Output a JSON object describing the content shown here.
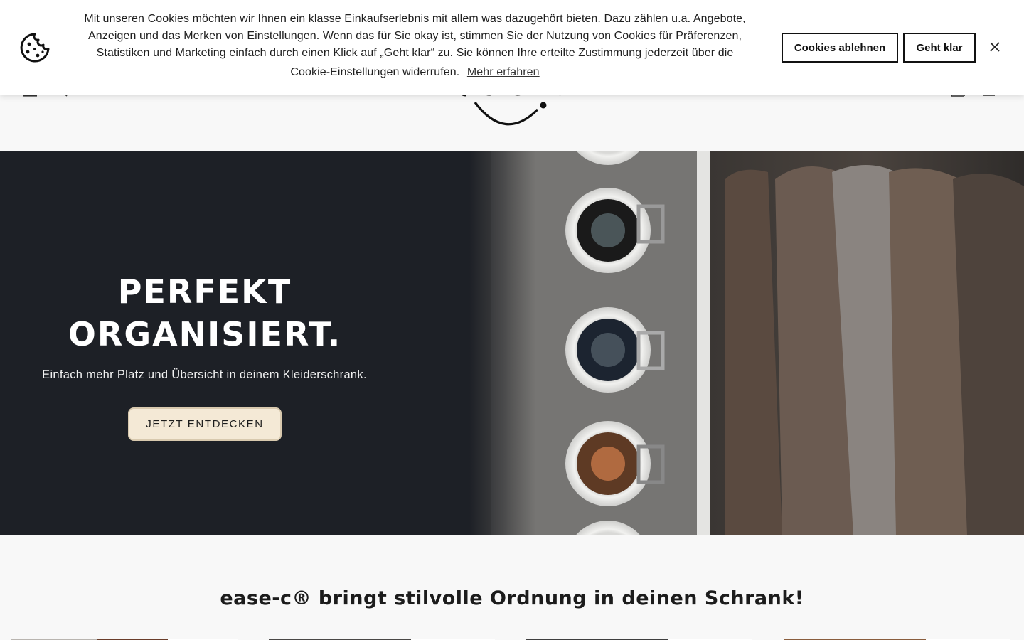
{
  "cookie_banner": {
    "text_lines": [
      "Mit unseren Cookies möchten wir Ihnen ein klasse Einkaufserlebnis mit allem was dazugehört bieten. Dazu zählen u.a. Angebote,",
      "Anzeigen und das Merken von Einstellungen. Wenn das für Sie okay ist, stimmen Sie der Nutzung von Cookies für Präferenzen,",
      "Statistiken und Marketing einfach durch einen Klick auf „Geht klar“ zu. Sie können Ihre erteilte Zustimmung jederzeit über die",
      "Cookie-Einstellungen widerrufen."
    ],
    "learn_more": "Mehr erfahren",
    "decline_label": "Cookies ablehnen",
    "accept_label": "Geht klar",
    "icon": "cookie-icon",
    "close_icon": "close-icon"
  },
  "header": {
    "icons": [
      "menu-icon",
      "search-icon",
      "account-icon",
      "cart-icon"
    ]
  },
  "hero": {
    "title_line1": "PERFEKT",
    "title_line2": "ORGANISIERT.",
    "subtitle": "Einfach mehr Platz und Übersicht in deinem Kleiderschrank.",
    "cta_label": "JETZT ENTDECKEN"
  },
  "section": {
    "title": "ease-c® bringt stilvolle Ordnung in deinen Schrank!"
  },
  "colors": {
    "hero_bg": "#1d2026",
    "cta_bg": "#f4e9d6",
    "page_bg": "#f8f8f8"
  }
}
